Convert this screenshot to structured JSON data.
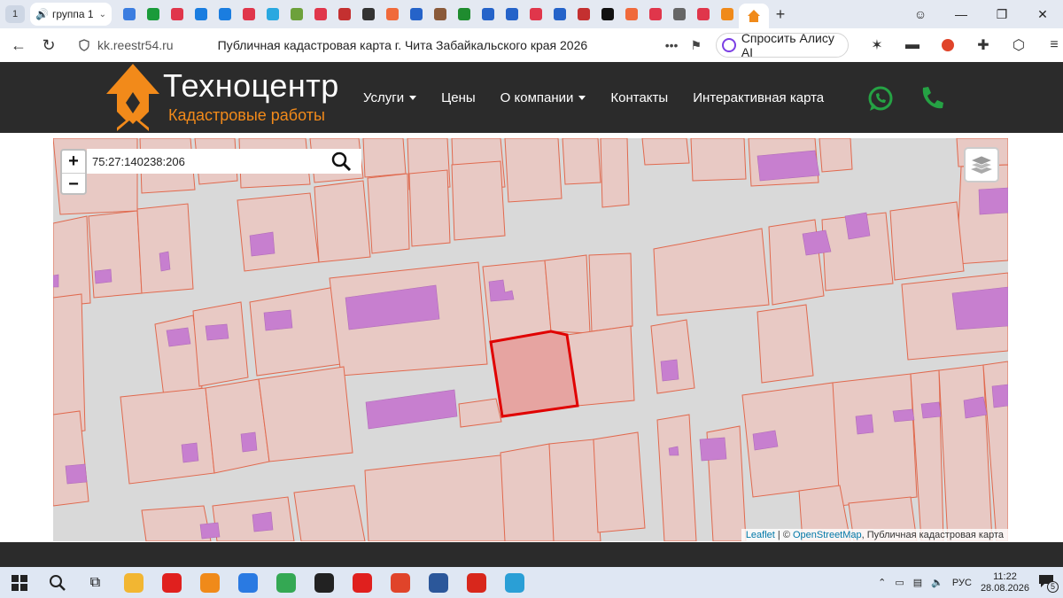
{
  "browser": {
    "tab_counter": "1",
    "tab_group_label": "группа 1",
    "url_domain": "kk.reestr54.ru",
    "page_title": "Публичная кадастровая карта г. Чита Забайкальского края 2026",
    "alice_label": "Спросить Алису AI",
    "tab_icons": [
      "#3b7de0",
      "#1a9b3a",
      "#e0364b",
      "#1a7de0",
      "#1a7de0",
      "#e0364b",
      "#29a8e0",
      "#6da13b",
      "#e0364b",
      "#c43030",
      "#333333",
      "#f06a3b",
      "#2563c9",
      "#8a5a3a",
      "#1f8c2f",
      "#2563c9",
      "#2563c9",
      "#e0364b",
      "#2563c9",
      "#c43030",
      "#111111",
      "#f06a3b",
      "#e0364b",
      "#666666",
      "#e0364b",
      "#f08a1a"
    ]
  },
  "site": {
    "logo_name": "Техноцентр",
    "logo_subtitle": "Кадастровые работы",
    "menu": [
      {
        "label": "Услуги",
        "dropdown": true
      },
      {
        "label": "Цены",
        "dropdown": false
      },
      {
        "label": "О компании",
        "dropdown": true
      },
      {
        "label": "Контакты",
        "dropdown": false
      },
      {
        "label": "Интерактивная карта",
        "dropdown": false
      }
    ],
    "colors": {
      "header_bg": "#2b2b2b",
      "accent": "#f28a1a",
      "whatsapp": "#25a244",
      "phone": "#25a244"
    }
  },
  "map": {
    "zoom_in": "+",
    "zoom_out": "−",
    "search_value": "75:27:140238:206",
    "attribution_leaflet": "Leaflet",
    "attribution_sep": " | © ",
    "attribution_osm": "OpenStreetMap",
    "attribution_rest": ", Публичная кадастровая карта",
    "colors": {
      "parcel_fill": "#e8c9c4",
      "parcel_stroke": "#e0694e",
      "building": "#c77fcf",
      "selected_fill": "#e89a96",
      "selected_stroke": "#e00000",
      "road": "#d9d9d9"
    }
  },
  "taskbar": {
    "lang": "РУС",
    "time": "11:22",
    "date": "28.08.2026",
    "notifications": "5"
  }
}
